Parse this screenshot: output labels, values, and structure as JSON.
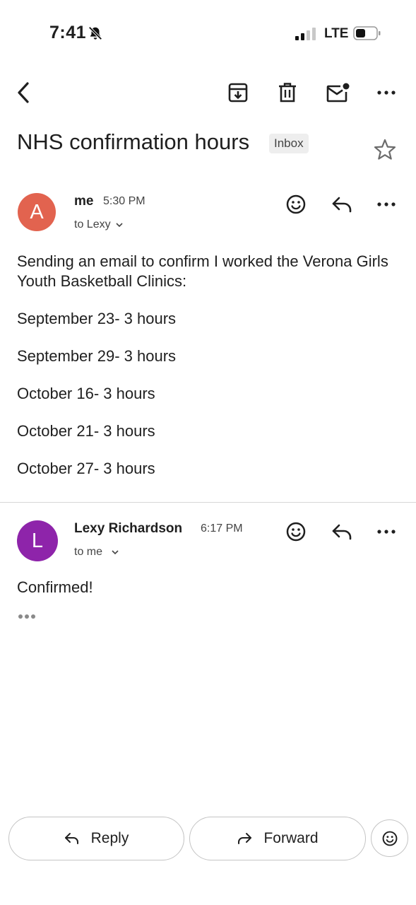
{
  "status_bar": {
    "time": "7:41",
    "network": "LTE"
  },
  "email": {
    "subject": "NHS confirmation hours",
    "label": "Inbox",
    "messages": [
      {
        "avatar_letter": "A",
        "avatar_color": "#e2634f",
        "sender": "me",
        "time": "5:30 PM",
        "recipient": "to Lexy",
        "body": [
          "Sending an email to confirm I worked the Verona Girls Youth Basketball Clinics:",
          "September 23- 3 hours",
          "September 29- 3 hours",
          "October 16- 3 hours",
          "October 21- 3 hours",
          "October 27- 3 hours"
        ]
      },
      {
        "avatar_letter": "L",
        "avatar_color": "#8e24aa",
        "sender": "Lexy Richardson",
        "time": "6:17 PM",
        "recipient": "to me",
        "body": [
          "Confirmed!"
        ]
      }
    ]
  },
  "actions": {
    "reply_label": "Reply",
    "forward_label": "Forward"
  },
  "icons": {
    "toolbar": [
      "back-arrow-icon",
      "archive-icon",
      "trash-icon",
      "mark-unread-icon",
      "more-icon"
    ],
    "message": [
      "emoji-icon",
      "reply-icon",
      "more-icon"
    ]
  }
}
